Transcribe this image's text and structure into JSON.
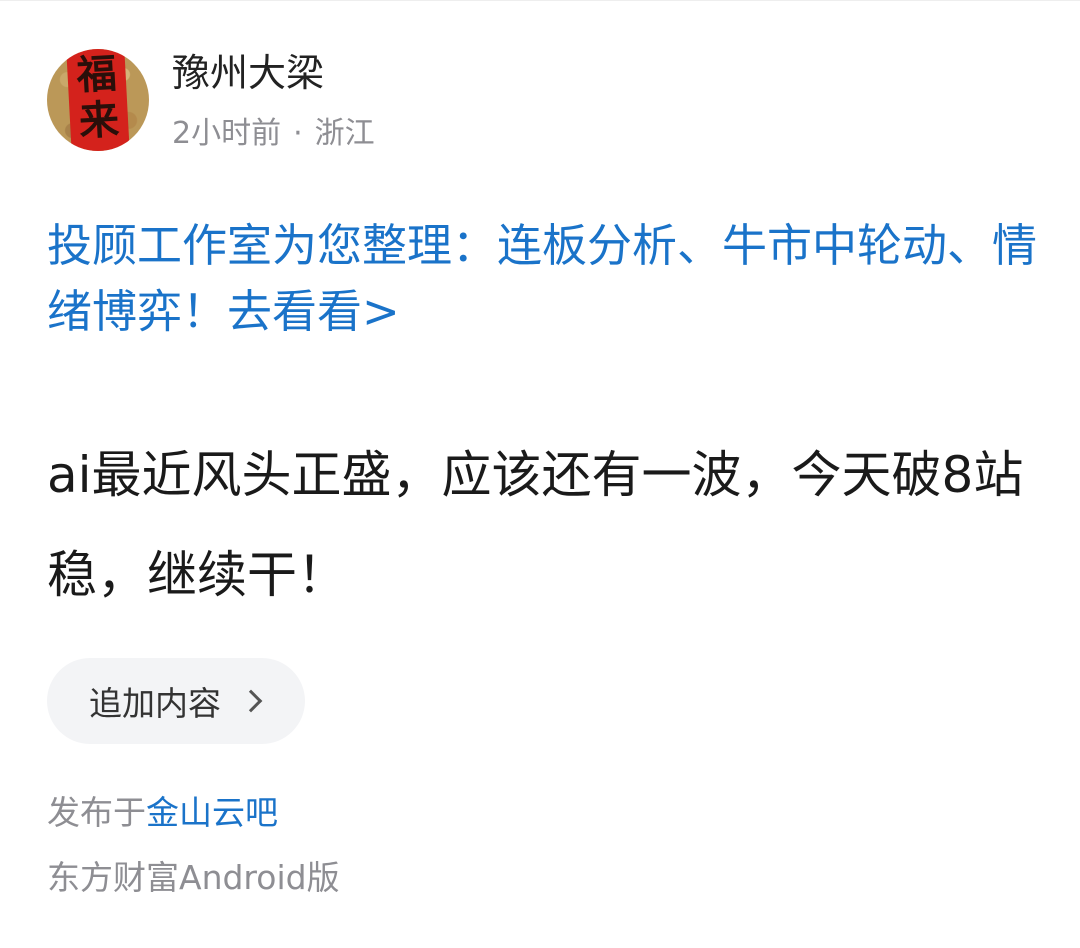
{
  "user": {
    "name": "豫州大梁",
    "avatar_icon": "fu-lai-banner-avatar",
    "avatar_text": [
      "福",
      "来"
    ],
    "time": "2小时前",
    "separator": "·",
    "location": "浙江"
  },
  "promo": {
    "text": "投顾工作室为您整理：连板分析、牛市中轮动、情绪博弈！去看看>"
  },
  "post": {
    "content": "ai最近风头正盛，应该还有一波，今天破8站稳，继续干！"
  },
  "add_content": {
    "label": "追加内容",
    "icon": "chevron-right-icon"
  },
  "published": {
    "prefix": "发布于",
    "bar_name": "金山云吧"
  },
  "source": {
    "text": "东方财富Android版"
  },
  "colors": {
    "link": "#1a73c9",
    "secondary_text": "#8e8e93",
    "primary_text": "#1a1a1a"
  }
}
